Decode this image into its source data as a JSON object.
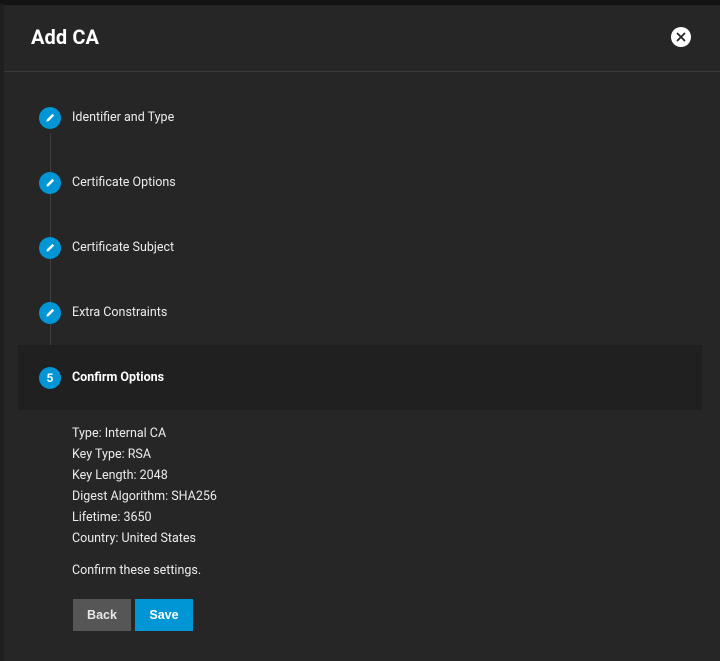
{
  "dialog": {
    "title": "Add CA",
    "close_icon": "close-icon"
  },
  "stepper": {
    "steps": [
      {
        "label": "Identifier and Type",
        "state": "edit",
        "icon": "pencil-icon"
      },
      {
        "label": "Certificate Options",
        "state": "edit",
        "icon": "pencil-icon"
      },
      {
        "label": "Certificate Subject",
        "state": "edit",
        "icon": "pencil-icon"
      },
      {
        "label": "Extra Constraints",
        "state": "edit",
        "icon": "pencil-icon"
      },
      {
        "label": "Confirm Options",
        "state": "active",
        "number": "5"
      }
    ]
  },
  "summary": {
    "lines": [
      "Type: Internal CA",
      "Key Type: RSA",
      "Key Length: 2048",
      "Digest Algorithm: SHA256",
      "Lifetime: 3650",
      "Country: United States"
    ],
    "confirm_text": "Confirm these settings."
  },
  "actions": {
    "back_label": "Back",
    "save_label": "Save"
  },
  "colors": {
    "accent": "#0095d5",
    "background": "#262626",
    "back_button": "#565656"
  }
}
